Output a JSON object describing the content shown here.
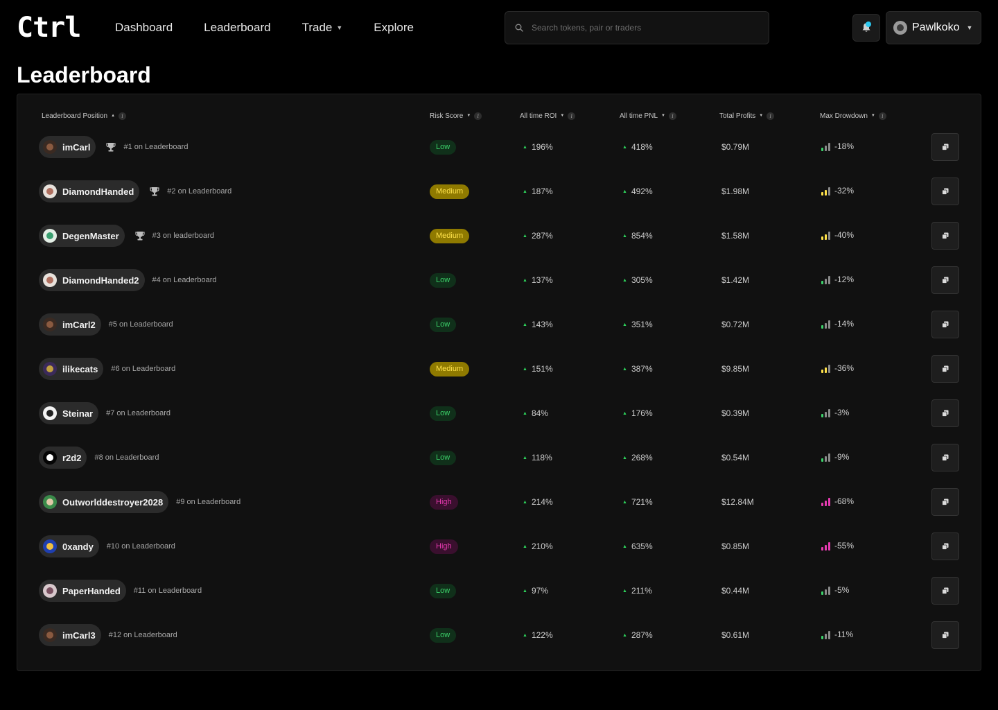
{
  "app": {
    "logo": "Ctrl",
    "nav": [
      "Dashboard",
      "Leaderboard",
      "Trade",
      "Explore"
    ],
    "search_placeholder": "Search tokens, pair or traders",
    "user_name": "Pawlkoko"
  },
  "page": {
    "title": "Leaderboard"
  },
  "table": {
    "headers": [
      "Leaderboard Position",
      "Risk Score",
      "All time ROI",
      "All time PNL",
      "Total Profits",
      "Max Drowdown"
    ],
    "rows": [
      {
        "name": "imCarl",
        "rank": "#1 on Leaderboard",
        "trophy": true,
        "risk": "Low",
        "roi": "196%",
        "pnl": "418%",
        "profits": "$0.79M",
        "drawdown": "-18%",
        "avatar_bg": "#3a2a22",
        "avatar_fg": "#8a5a40"
      },
      {
        "name": "DiamondHanded",
        "rank": "#2 on Leaderboard",
        "trophy": true,
        "risk": "Medium",
        "roi": "187%",
        "pnl": "492%",
        "profits": "$1.98M",
        "drawdown": "-32%",
        "avatar_bg": "#e8e2dc",
        "avatar_fg": "#b07060"
      },
      {
        "name": "DegenMaster",
        "rank": "#3 on leaderboard",
        "trophy": true,
        "risk": "Medium",
        "roi": "287%",
        "pnl": "854%",
        "profits": "$1.58M",
        "drawdown": "-40%",
        "avatar_bg": "#e4efe6",
        "avatar_fg": "#3aa070"
      },
      {
        "name": "DiamondHanded2",
        "rank": "#4 on Leaderboard",
        "trophy": false,
        "risk": "Low",
        "roi": "137%",
        "pnl": "305%",
        "profits": "$1.42M",
        "drawdown": "-12%",
        "avatar_bg": "#e8e2dc",
        "avatar_fg": "#b07060"
      },
      {
        "name": "imCarl2",
        "rank": "#5 on Leaderboard",
        "trophy": false,
        "risk": "Low",
        "roi": "143%",
        "pnl": "351%",
        "profits": "$0.72M",
        "drawdown": "-14%",
        "avatar_bg": "#3a2a22",
        "avatar_fg": "#8a5a40"
      },
      {
        "name": "ilikecats",
        "rank": "#6 on Leaderboard",
        "trophy": false,
        "risk": "Medium",
        "roi": "151%",
        "pnl": "387%",
        "profits": "$9.85M",
        "drawdown": "-36%",
        "avatar_bg": "#3b2a5a",
        "avatar_fg": "#c0a040"
      },
      {
        "name": "Steinar",
        "rank": "#7 on Leaderboard",
        "trophy": false,
        "risk": "Low",
        "roi": "84%",
        "pnl": "176%",
        "profits": "$0.39M",
        "drawdown": "-3%",
        "avatar_bg": "#f4f4f4",
        "avatar_fg": "#222222"
      },
      {
        "name": "r2d2",
        "rank": "#8 on Leaderboard",
        "trophy": false,
        "risk": "Low",
        "roi": "118%",
        "pnl": "268%",
        "profits": "$0.54M",
        "drawdown": "-9%",
        "avatar_bg": "#050505",
        "avatar_fg": "#ffffff"
      },
      {
        "name": "Outworlddestroyer2028",
        "rank": "#9 on Leaderboard",
        "trophy": false,
        "risk": "High",
        "roi": "214%",
        "pnl": "721%",
        "profits": "$12.84M",
        "drawdown": "-68%",
        "avatar_bg": "#3a8a4a",
        "avatar_fg": "#e0c8a8"
      },
      {
        "name": "0xandy",
        "rank": "#10 on Leaderboard",
        "trophy": false,
        "risk": "High",
        "roi": "210%",
        "pnl": "635%",
        "profits": "$0.85M",
        "drawdown": "-55%",
        "avatar_bg": "#1f3fb0",
        "avatar_fg": "#f0c040"
      },
      {
        "name": "PaperHanded",
        "rank": "#11 on Leaderboard",
        "trophy": false,
        "risk": "Low",
        "roi": "97%",
        "pnl": "211%",
        "profits": "$0.44M",
        "drawdown": "-5%",
        "avatar_bg": "#d8c8cc",
        "avatar_fg": "#7a5060"
      },
      {
        "name": "imCarl3",
        "rank": "#12 on Leaderboard",
        "trophy": false,
        "risk": "Low",
        "roi": "122%",
        "pnl": "287%",
        "profits": "$0.61M",
        "drawdown": "-11%",
        "avatar_bg": "#3a2a22",
        "avatar_fg": "#8a5a40"
      }
    ]
  },
  "colors": {
    "low": "#3cd26a",
    "medium": "#ffe24a",
    "high": "#e83ab1",
    "up_arrow": "#2ed45c",
    "notification_dot": "#2bc8f0",
    "bar_dim": "#8a8a8a"
  },
  "icons": {
    "search": "search-icon",
    "bell": "bell-icon",
    "trophy": "trophy-icon",
    "copy": "copy-icon",
    "chevron": "chevron-down-icon",
    "info": "info-icon",
    "sort": "sort-icon"
  }
}
